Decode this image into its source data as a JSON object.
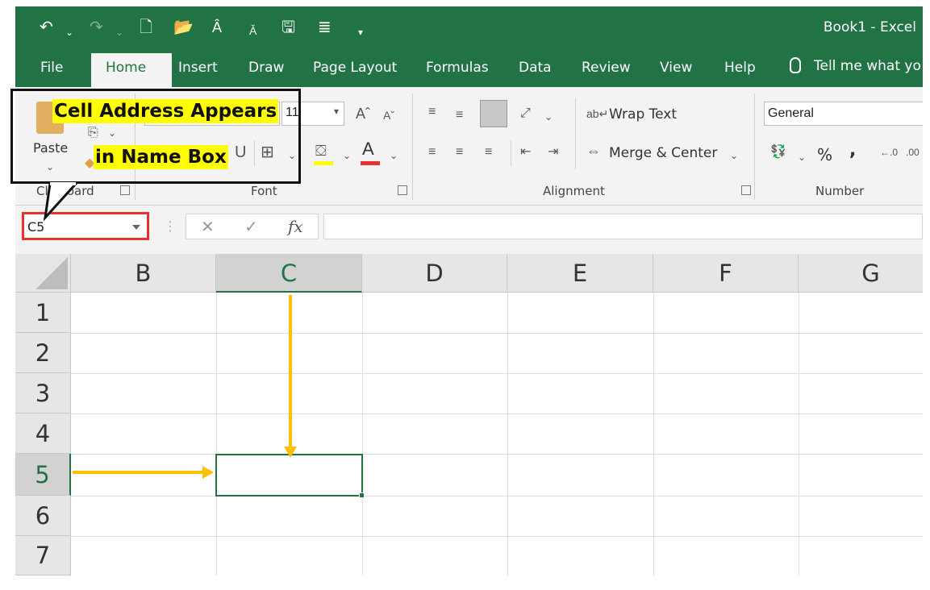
{
  "window": {
    "title": "Book1  -  Excel"
  },
  "tabs": [
    {
      "label": "File"
    },
    {
      "label": "Home"
    },
    {
      "label": "Insert"
    },
    {
      "label": "Draw"
    },
    {
      "label": "Page Layout"
    },
    {
      "label": "Formulas"
    },
    {
      "label": "Data"
    },
    {
      "label": "Review"
    },
    {
      "label": "View"
    },
    {
      "label": "Help"
    }
  ],
  "tell_me": "Tell me what yo",
  "ribbon": {
    "clipboard": {
      "label": "Clipboard",
      "paste": "Paste"
    },
    "font": {
      "label": "Font",
      "size": "11"
    },
    "alignment": {
      "label": "Alignment",
      "wrap_text": "Wrap Text",
      "merge_center": "Merge & Center"
    },
    "number": {
      "label": "Number",
      "format": "General",
      "percent": "%",
      "comma": ","
    }
  },
  "name_box": {
    "value": "C5"
  },
  "formula_bar": {
    "fx": "fx"
  },
  "grid": {
    "columns": [
      "B",
      "C",
      "D",
      "E",
      "F",
      "G"
    ],
    "rows": [
      "1",
      "2",
      "3",
      "4",
      "5",
      "6",
      "7"
    ],
    "selected_cell": "C5"
  },
  "annotation": {
    "line1": "Cell Address Appears",
    "line2": "in Name Box",
    "arrow_color": "#ffc000",
    "box_color": "#e8322f"
  }
}
